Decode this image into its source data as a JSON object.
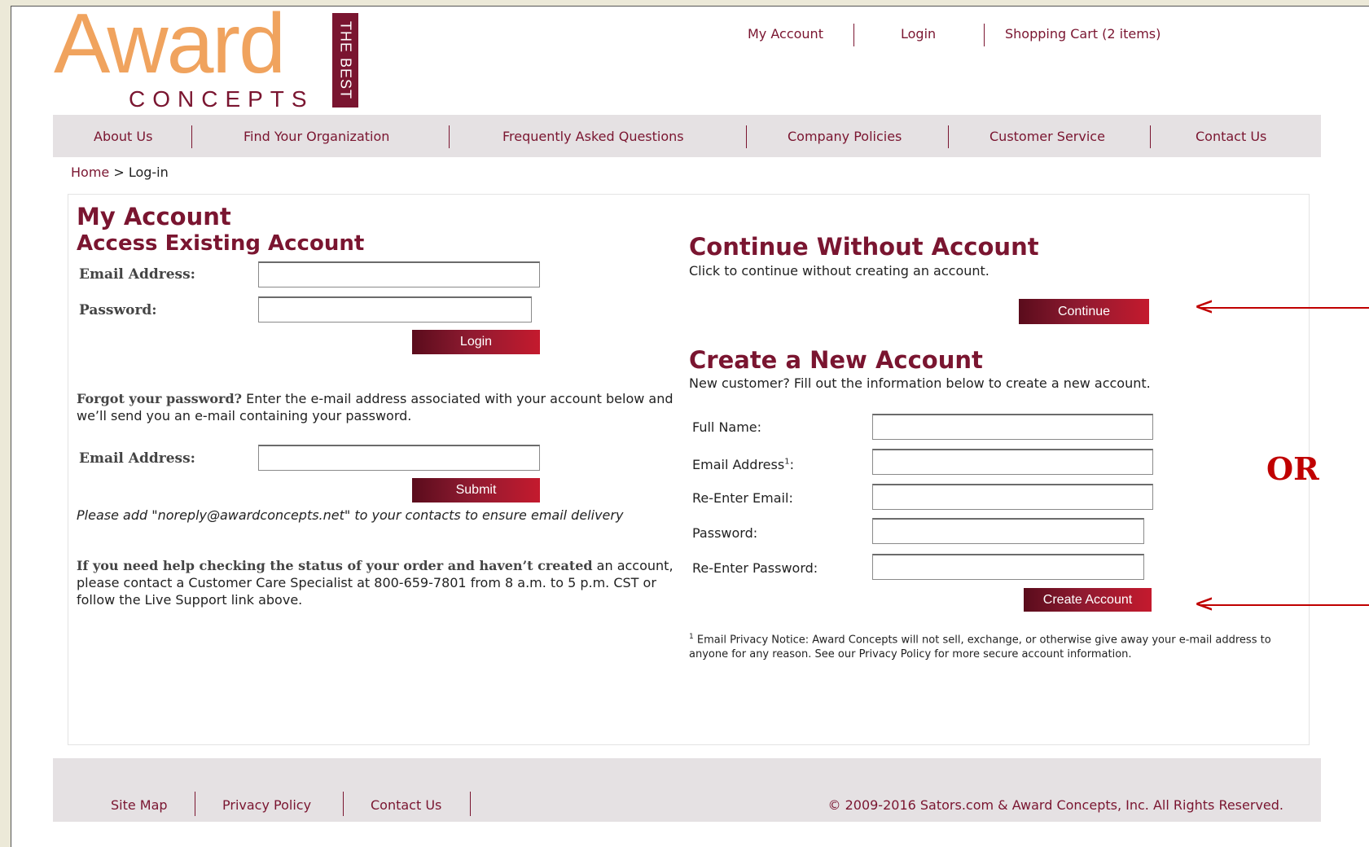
{
  "logo": {
    "award": "Award",
    "concepts": "CONCEPTS",
    "tagline": "THE BEST"
  },
  "top_links": {
    "my_account": "My Account",
    "login": "Login",
    "cart": "Shopping Cart (2 items)"
  },
  "nav": [
    "About Us",
    "Find Your Organization",
    "Frequently Asked Questions",
    "Company Policies",
    "Customer Service",
    "Contact Us"
  ],
  "breadcrumb": {
    "home": "Home",
    "separator": " > ",
    "current": "Log-in"
  },
  "left": {
    "title": "My Account",
    "subtitle": "Access Existing Account",
    "email_label": "Email Address:",
    "password_label": "Password:",
    "login_button": "Login",
    "forgot_bold": "Forgot your password?",
    "forgot_text": " Enter the e-mail address associated with your account below and we’ll send you an e-mail containing your password.",
    "forgot_email_label": "Email Address:",
    "submit_button": "Submit",
    "noreply_note": "Please add \"noreply@awardconcepts.net\" to your contacts to ensure email delivery",
    "help_bold": "If you need help checking the status of your order and haven’t created",
    "help_text": " an account, please contact a Customer Care Specialist at 800-659-7801 from 8 a.m. to 5 p.m. CST or follow the Live Support link above."
  },
  "right": {
    "continue_title": "Continue Without Account",
    "continue_text": "Click to continue without creating an account.",
    "continue_button": "Continue",
    "create_title": "Create a New Account",
    "create_text": "New customer? Fill out the information below to create a new account.",
    "full_name_label": "Full Name:",
    "email_label": "Email Address",
    "email_sup": "1",
    "email_colon": ":",
    "reenter_email_label": "Re-Enter Email:",
    "password_label": "Password:",
    "reenter_password_label": "Re-Enter Password:",
    "create_button": "Create Account",
    "privacy_sup": "1",
    "privacy_text": " Email Privacy Notice: Award Concepts will not sell, exchange, or otherwise give away your e-mail address to anyone for any reason. See our Privacy Policy for more secure account information."
  },
  "annotation": {
    "or": "OR"
  },
  "footer": {
    "links": [
      "Site Map",
      "Privacy Policy",
      "Contact Us"
    ],
    "copyright": "© 2009-2016 Sators.com & Award Concepts, Inc. All Rights Reserved."
  },
  "colors": {
    "brand": "#7a1530",
    "logo_orange": "#f0a35e",
    "annotation_red": "#c00000",
    "nav_bg": "#e5e1e3"
  }
}
